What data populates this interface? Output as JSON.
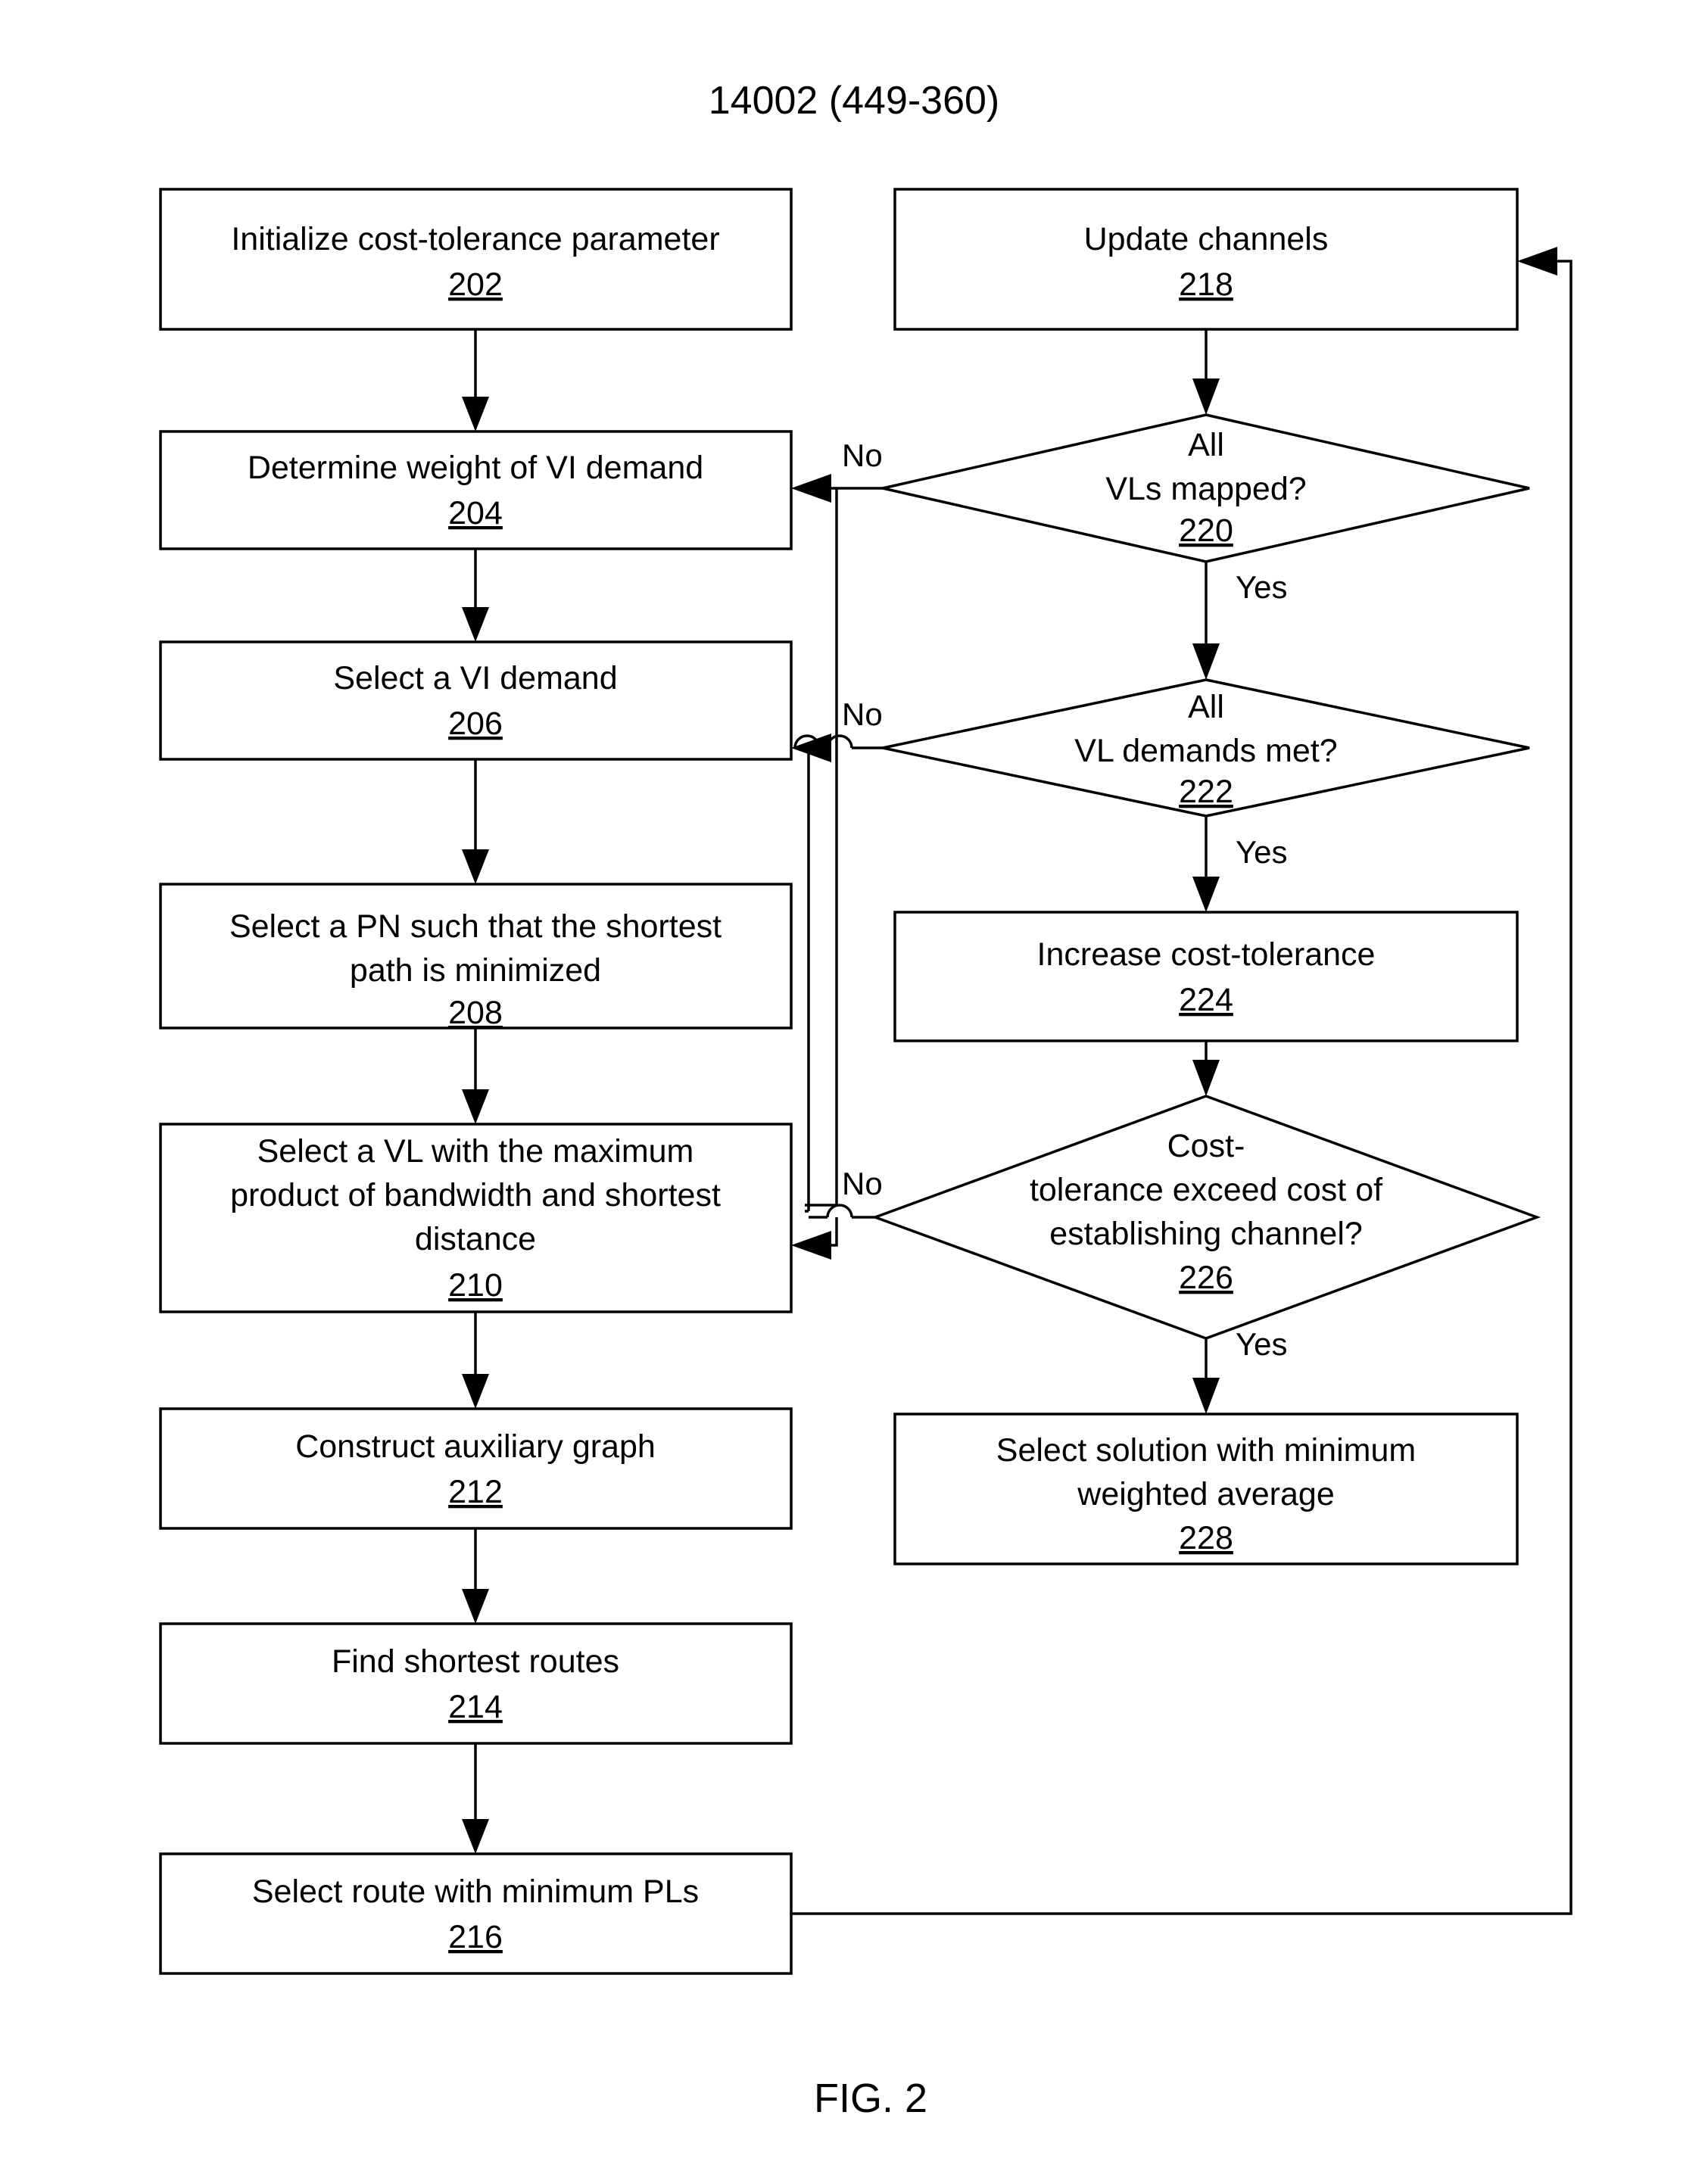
{
  "header": {
    "title": "14002 (449-360)"
  },
  "figure": {
    "caption": "FIG. 2"
  },
  "nodes": {
    "n202": {
      "label_line1": "Initialize cost-tolerance parameter",
      "number": "202"
    },
    "n204": {
      "label_line1": "Determine weight of VI demand",
      "number": "204"
    },
    "n206": {
      "label_line1": "Select a VI demand",
      "number": "206"
    },
    "n208": {
      "label_line1": "Select a PN such that the shortest",
      "label_line2": "path is minimized",
      "number": "208"
    },
    "n210": {
      "label_line1": "Select a VL with the maximum",
      "label_line2": "product of bandwidth and shortest",
      "label_line3": "distance",
      "number": "210"
    },
    "n212": {
      "label_line1": "Construct auxiliary graph",
      "number": "212"
    },
    "n214": {
      "label_line1": "Find shortest routes",
      "number": "214"
    },
    "n216": {
      "label_line1": "Select route with minimum PLs",
      "number": "216"
    },
    "n218": {
      "label_line1": "Update channels",
      "number": "218"
    },
    "n220": {
      "label_line1": "All",
      "label_line2": "VLs mapped?",
      "number": "220"
    },
    "n222": {
      "label_line1": "All",
      "label_line2": "VL demands met?",
      "number": "222"
    },
    "n224": {
      "label_line1": "Increase cost-tolerance",
      "number": "224"
    },
    "n226": {
      "label_line1": "Cost-",
      "label_line2": "tolerance exceed cost of",
      "label_line3": "establishing channel?",
      "number": "226"
    },
    "n228": {
      "label_line1": "Select solution with minimum",
      "label_line2": "weighted average",
      "number": "228"
    }
  },
  "edge_labels": {
    "no_220": "No",
    "yes_220": "Yes",
    "no_222": "No",
    "yes_222": "Yes",
    "no_226": "No",
    "yes_226": "Yes"
  },
  "colors": {
    "ink": "#000000",
    "paper": "#ffffff"
  }
}
